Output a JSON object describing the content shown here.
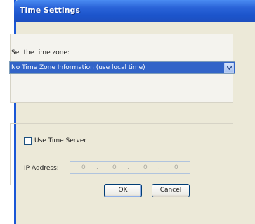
{
  "window": {
    "title": "Time Settings"
  },
  "timezone": {
    "label": "Set the time zone:",
    "selected": "No Time Zone Information (use local time)"
  },
  "time_server": {
    "checkbox_label": "Use Time Server",
    "checked": false,
    "ip_label": "IP Address:",
    "ip_octets": [
      "0",
      "0",
      "0",
      "0"
    ]
  },
  "buttons": {
    "ok": "OK",
    "cancel": "Cancel"
  },
  "colors": {
    "title_bar": "#1c55cc",
    "dialog_bg": "#ece9d8",
    "selection": "#3264c8"
  }
}
